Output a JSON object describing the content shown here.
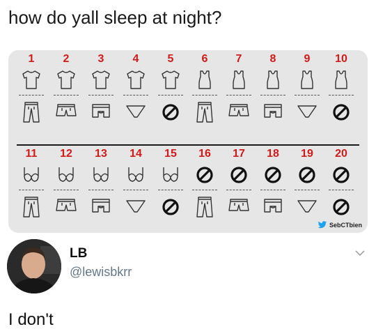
{
  "post": {
    "heading": "how do yall sleep at night?"
  },
  "infographic": {
    "credit": "SebCTbien",
    "cells": [
      {
        "number": "1",
        "top": "tshirt",
        "bottom": "pants"
      },
      {
        "number": "2",
        "top": "tshirt",
        "bottom": "shorts"
      },
      {
        "number": "3",
        "top": "tshirt",
        "bottom": "boxers"
      },
      {
        "number": "4",
        "top": "tshirt",
        "bottom": "briefs"
      },
      {
        "number": "5",
        "top": "tshirt",
        "bottom": "none"
      },
      {
        "number": "6",
        "top": "tanktop",
        "bottom": "pants"
      },
      {
        "number": "7",
        "top": "tanktop",
        "bottom": "shorts"
      },
      {
        "number": "8",
        "top": "tanktop",
        "bottom": "boxers"
      },
      {
        "number": "9",
        "top": "tanktop",
        "bottom": "briefs"
      },
      {
        "number": "10",
        "top": "tanktop",
        "bottom": "none"
      },
      {
        "number": "11",
        "top": "bra",
        "bottom": "pants"
      },
      {
        "number": "12",
        "top": "bra",
        "bottom": "shorts"
      },
      {
        "number": "13",
        "top": "bra",
        "bottom": "boxers"
      },
      {
        "number": "14",
        "top": "bra",
        "bottom": "briefs"
      },
      {
        "number": "15",
        "top": "bra",
        "bottom": "none"
      },
      {
        "number": "16",
        "top": "none",
        "bottom": "pants"
      },
      {
        "number": "17",
        "top": "none",
        "bottom": "shorts"
      },
      {
        "number": "18",
        "top": "none",
        "bottom": "boxers"
      },
      {
        "number": "19",
        "top": "none",
        "bottom": "briefs"
      },
      {
        "number": "20",
        "top": "none",
        "bottom": "none"
      }
    ]
  },
  "reply": {
    "display_name": "LB",
    "handle": "@lewisbkrr",
    "text": "I don't"
  }
}
